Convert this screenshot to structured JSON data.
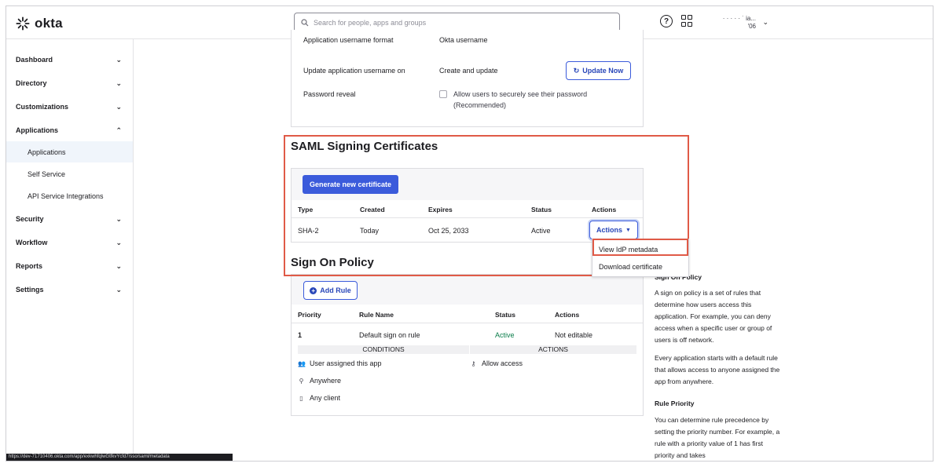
{
  "brand": {
    "name": "okta"
  },
  "search": {
    "placeholder": "Search for people, apps and groups"
  },
  "user": {
    "line1": "· ·   ·  · ·  ˙  ia...",
    "line2": "'06"
  },
  "sidebar": {
    "items": [
      {
        "label": "Dashboard"
      },
      {
        "label": "Directory"
      },
      {
        "label": "Customizations"
      },
      {
        "label": "Applications"
      },
      {
        "label": "Security"
      },
      {
        "label": "Workflow"
      },
      {
        "label": "Reports"
      },
      {
        "label": "Settings"
      }
    ],
    "subitems": [
      {
        "label": "Applications"
      },
      {
        "label": "Self Service"
      },
      {
        "label": "API Service Integrations"
      }
    ]
  },
  "credentials": {
    "format_label": "Application username format",
    "format_value": "Okta username",
    "update_label": "Update application username on",
    "update_value": "Create and update",
    "update_button": "Update Now",
    "reveal_label": "Password reveal",
    "reveal_text_1": "Allow users to securely see their password",
    "reveal_text_2": "(Recommended)",
    "reveal_checked": false
  },
  "saml": {
    "title": "SAML Signing Certificates",
    "generate_button": "Generate new certificate",
    "columns": [
      "Type",
      "Created",
      "Expires",
      "Status",
      "Actions"
    ],
    "rows": [
      {
        "type": "SHA-2",
        "created": "Today",
        "expires": "Oct 25, 2033",
        "status": "Active",
        "actions": "Actions"
      }
    ],
    "dropdown": [
      "View IdP metadata",
      "Download certificate"
    ]
  },
  "policy": {
    "title": "Sign On Policy",
    "add_rule": "Add Rule",
    "columns": [
      "Priority",
      "Rule Name",
      "Status",
      "Actions"
    ],
    "rules": [
      {
        "priority": "1",
        "name": "Default sign on rule",
        "status": "Active",
        "actions": "Not editable"
      }
    ],
    "conditions_label": "CONDITIONS",
    "actions_label": "ACTIONS",
    "conditions": [
      "User assigned this app",
      "Anywhere",
      "Any client"
    ],
    "actions": [
      "Allow access"
    ]
  },
  "help": {
    "title1": "Sign On Policy",
    "p1": "A sign on policy is a set of rules that determine how users access this application. For example, you can deny access when a specific user or group of users is off network.",
    "p2": "Every application starts with a default rule that allows access to anyone assigned the app from anywhere.",
    "title2": "Rule Priority",
    "p3": "You can determine rule precedence by setting the priority number. For example, a rule with a priority value of 1 has first priority and takes"
  },
  "statusbar": {
    "url": "https://dev-71710406.okta.com/app/exkwhfqlwGtfkvYcfd7/sso/saml/metadata"
  },
  "colors": {
    "primary": "#3b5bdb",
    "highlight": "#e05a47",
    "active_status": "#0a7d4a"
  }
}
